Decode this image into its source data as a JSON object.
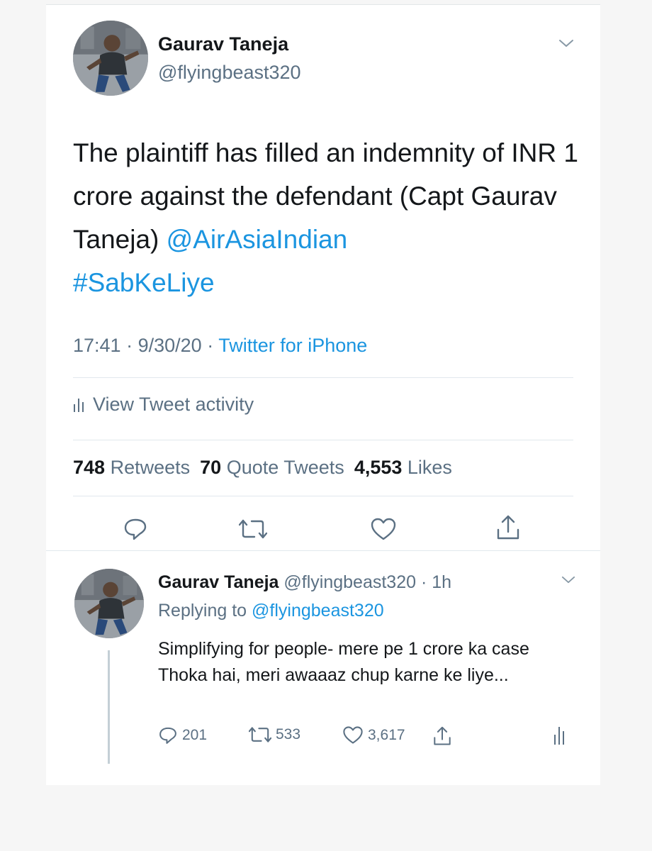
{
  "main_tweet": {
    "author_name": "Gaurav Taneja",
    "author_handle": "@flyingbeast320",
    "text_plain": "The plaintiff has filled an indemnity of INR 1 crore against the defendant (Capt Gaurav Taneja)",
    "mention": "@AirAsiaIndian",
    "hashtag": "#SabKeLiye",
    "time": "17:41",
    "date": "9/30/20",
    "separator": "·",
    "source": "Twitter for iPhone",
    "activity_label": "View Tweet activity",
    "stats": {
      "retweets_count": "748",
      "retweets_label": "Retweets",
      "quotes_count": "70",
      "quotes_label": "Quote Tweets",
      "likes_count": "4,553",
      "likes_label": "Likes"
    }
  },
  "reply_tweet": {
    "author_name": "Gaurav Taneja",
    "author_handle": "@flyingbeast320",
    "time_ago": "· 1h",
    "replying_prefix": "Replying to",
    "replying_handle": "@flyingbeast320",
    "text": "Simplifying for people- mere pe 1 crore ka case Thoka hai, meri awaaaz chup karne ke liye...",
    "replies": "201",
    "retweets": "533",
    "likes": "3,617"
  },
  "icons": {
    "reply": "reply-icon",
    "retweet": "retweet-icon",
    "like": "heart-icon",
    "share": "share-icon",
    "analytics": "analytics-icon",
    "more": "chevron-down-icon"
  },
  "colors": {
    "link": "#1b95e0",
    "secondary_text": "#5b7083",
    "primary_text": "#14171a",
    "divider": "#e1e8ed"
  }
}
